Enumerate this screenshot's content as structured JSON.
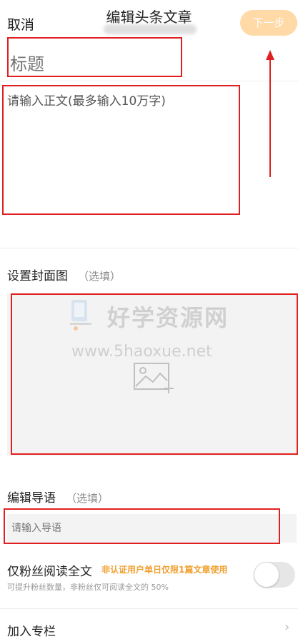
{
  "header": {
    "cancel_label": "取消",
    "title": "编辑头条文章",
    "next_label": "下一步"
  },
  "editor": {
    "title_placeholder": "标题",
    "body_placeholder": "请输入正文(最多输入10万字)"
  },
  "cover": {
    "label": "设置封面图",
    "optional": "（选填）",
    "icon": "add-image-icon"
  },
  "watermark": {
    "name": "好学资源网",
    "url": "www.5haoxue.net"
  },
  "intro": {
    "label": "编辑导语",
    "optional": "（选填）",
    "placeholder": "请输入导语"
  },
  "fans_only": {
    "label": "仅粉丝阅读全文",
    "note": "非认证用户单日仅限1篇文章使用",
    "sub": "可提升粉丝数量，非粉丝仅可阅读全文的 50%",
    "enabled": false
  },
  "column": {
    "label": "加入专栏"
  },
  "colors": {
    "accent": "#ffd9a6",
    "annotation": "#e02020",
    "warning": "#f0a030"
  }
}
